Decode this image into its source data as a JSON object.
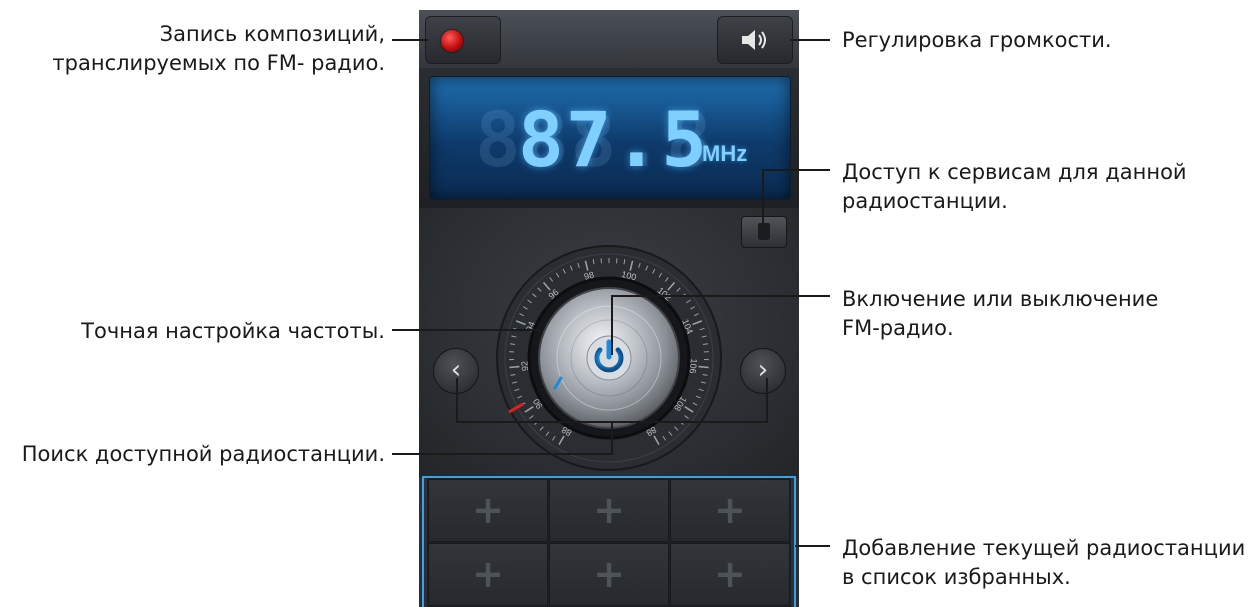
{
  "callouts": {
    "record": "Запись композиций,\nтранслируемых по FM- радио.",
    "volume": "Регулировка громкости.",
    "rds": "Доступ к сервисам для данной\nрадиостанции.",
    "power": "Включение или выключение\nFM-радио.",
    "fine_tune": "Точная настройка частоты.",
    "search": "Поиск доступной радиостанции.",
    "favorites": "Добавление текущей радиостанции\nв список избранных."
  },
  "radio": {
    "frequency": "87.5",
    "frequency_ghost": "888.8",
    "unit": "MHz",
    "prev_label": "‹",
    "next_label": "›",
    "dial_ticks": [
      "88",
      "90",
      "92",
      "94",
      "96",
      "98",
      "100",
      "102",
      "104",
      "106",
      "108",
      "88"
    ]
  },
  "favorites": [
    "+",
    "+",
    "+",
    "+",
    "+",
    "+"
  ],
  "colors": {
    "display_glow": "#7fd0ff",
    "record_red": "#c40d0d",
    "power_blue": "#1a8be0",
    "callout_line": "#1a1a1a"
  },
  "icons": [
    "record-icon",
    "speaker-icon",
    "rds-tag-icon",
    "chevron-left-icon",
    "chevron-right-icon",
    "power-icon",
    "plus-icon"
  ]
}
